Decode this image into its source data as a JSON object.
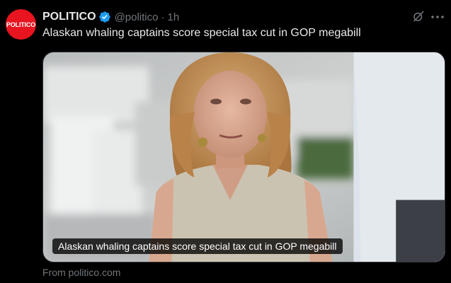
{
  "account": {
    "avatar_text": "POLITICO",
    "name": "POLITICO",
    "handle": "@politico",
    "separator": "·",
    "time": "1h"
  },
  "tweet": {
    "text": "Alaskan whaling captains score special tax cut in GOP megabill"
  },
  "card": {
    "caption": "Alaskan whaling captains score special tax cut in GOP megabill",
    "source": "From politico.com"
  },
  "icons": {
    "verified": "verified-badge-icon",
    "grok": "grok-icon",
    "more": "more-icon"
  },
  "colors": {
    "background": "#000000",
    "text": "#e7e9ea",
    "secondary": "#71767b",
    "verified": "#1d9bf0",
    "brand": "#e8141f"
  }
}
